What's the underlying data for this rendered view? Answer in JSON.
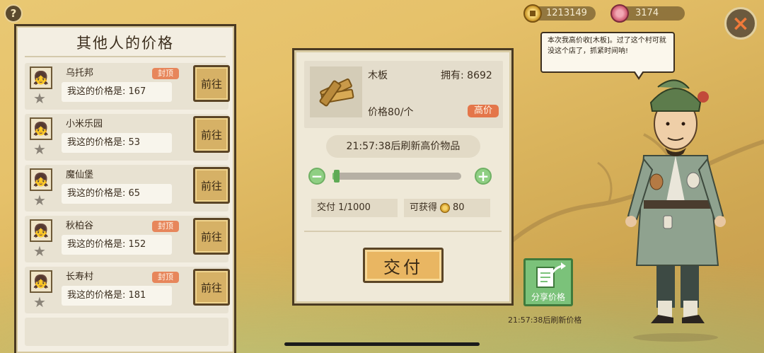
{
  "top_bar": {
    "help_label": "?",
    "coins": "1213149",
    "gems": "3174",
    "close_label": "×"
  },
  "others_panel": {
    "title": "其他人的价格",
    "rows": [
      {
        "name": "乌托邦",
        "badge": "封顶",
        "price_text": "我这的价格是: 167",
        "go_label": "前往"
      },
      {
        "name": "小米乐园",
        "badge": "",
        "price_text": "我这的价格是: 53",
        "go_label": "前往"
      },
      {
        "name": "魔仙堡",
        "badge": "",
        "price_text": "我这的价格是: 65",
        "go_label": "前往"
      },
      {
        "name": "秋柏谷",
        "badge": "封顶",
        "price_text": "我这的价格是: 152",
        "go_label": "前往"
      },
      {
        "name": "长寿村",
        "badge": "封顶",
        "price_text": "我这的价格是: 181",
        "go_label": "前往"
      }
    ]
  },
  "trade_panel": {
    "item_name": "木板",
    "owned_text": "拥有: 8692",
    "price_text": "价格80/个",
    "high_badge": "高价",
    "refresh_text": "21:57:38后刷新高价物品",
    "slider_fraction": 0.01,
    "deliver_text": "交付 1/1000",
    "obtain_label": "可获得",
    "obtain_value": "80",
    "submit_label": "交付"
  },
  "npc": {
    "speech": "本次我高价收[木板]。过了这个村可就没这个店了，抓紧时间呐!"
  },
  "share": {
    "label": "分享价格",
    "refresh_text": "21:57:38后刷新价格"
  },
  "colors": {
    "badge_orange": "#e7865b",
    "high_badge": "#e4764a",
    "share_green": "#7bc27a",
    "slider_green": "#7bbf6f"
  },
  "icons": [
    "help-icon",
    "coin-icon",
    "gem-icon",
    "close-icon",
    "avatar-icon",
    "star-icon",
    "wood-plank-icon",
    "minus-icon",
    "plus-icon",
    "share-icon"
  ]
}
